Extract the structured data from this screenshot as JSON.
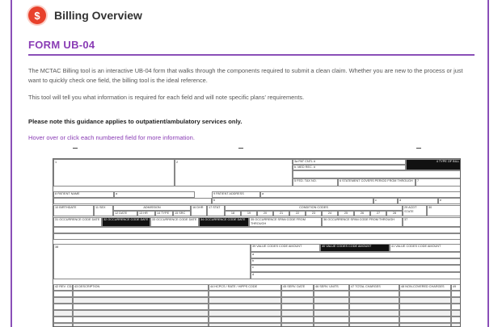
{
  "app": {
    "title": "Billing Overview",
    "logo_symbol": "$",
    "accent": "#8a3db5",
    "logo_color": "#e8412c"
  },
  "page": {
    "form_title": "FORM UB-04",
    "intro": "The MCTAC Billing tool is an interactive UB-04 form that walks through the components required to submit a clean claim. Whether you are new to the process or just want to quickly check one field, the billing tool is the ideal reference.",
    "detail": "This tool will tell you what information is required for each field and will note specific plans' requirements.",
    "note": "Please note this guidance applies to outpatient/ambulatory services only.",
    "hover_hint": "Hover over or click each numbered field for more information."
  },
  "form": {
    "f1": "1",
    "f2": "2",
    "f3a": "3a PAT CNTL #",
    "f3b": "b. MED REC. #",
    "f4": "4 TYPE OF BILL",
    "f5": "5 FED. TAX NO.",
    "f6": "6 STATEMENT COVERS PERIOD",
    "f6_from": "FROM",
    "f6_through": "THROUGH",
    "f7": "7",
    "f8": "8 PATIENT NAME",
    "f8a": "a",
    "f9": "9 PATIENT ADDRESS",
    "f9a": "a",
    "f9b": "b",
    "f9c": "c",
    "f9d": "d",
    "f9e": "e",
    "f10": "10 BIRTHDATE",
    "f11": "11 SEX",
    "f12": "12 DATE",
    "admission": "ADMISSION",
    "f13": "13 HR",
    "f14": "14 TYPE",
    "f15": "15 SRC",
    "f16": "16 DHR",
    "f17": "17 STAT",
    "condition": "CONDITION CODES",
    "cond_nums": [
      "18",
      "19",
      "20",
      "21",
      "22",
      "23",
      "24",
      "25",
      "26",
      "27",
      "28"
    ],
    "f29": "29 ACDT STATE",
    "f30": "30",
    "f31": "31 OCCURRENCE CODE DATE",
    "f32": "32 OCCURRENCE CODE DATE",
    "f33": "33 OCCURRENCE CODE DATE",
    "f34": "34 OCCURRENCE CODE DATE",
    "f35": "35 OCCURRENCE SPAN CODE FROM THROUGH",
    "f36": "36 OCCURRENCE SPAN CODE FROM THROUGH",
    "f37": "37",
    "f38": "38",
    "f39": "39 VALUE CODES CODE AMOUNT",
    "f40": "40 VALUE CODES CODE AMOUNT",
    "f41": "41 VALUE CODES CODE AMOUNT",
    "row_a": "a",
    "row_b": "b",
    "row_c": "c",
    "row_d": "d",
    "f42": "42 REV. CD.",
    "f43": "43 DESCRIPTION",
    "f44": "44 HCPCS / RATE / HIPPS CODE",
    "f45": "45 SERV. DATE",
    "f46": "46 SERV. UNITS",
    "f47": "47 TOTAL CHARGES",
    "f48": "48 NON-COVERED CHARGES",
    "f49": "49"
  }
}
